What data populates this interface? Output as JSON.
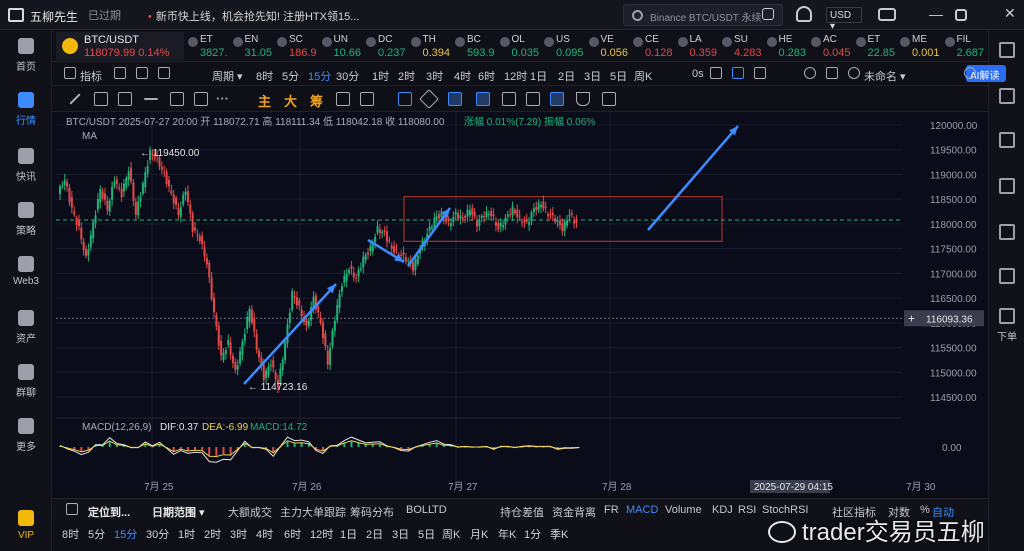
{
  "app": {
    "name": "五柳先生",
    "expired": "已过期",
    "notice": "新币快上线，机会抢先知! 注册HTX领15...",
    "search_placeholder": "Binance BTC/USDT 永续",
    "currency": "USD"
  },
  "left_sidebar": [
    {
      "label": "首页",
      "icon": "home-icon"
    },
    {
      "label": "行情",
      "icon": "bar-chart-icon",
      "active": true
    },
    {
      "label": "快讯",
      "icon": "news-icon"
    },
    {
      "label": "策略",
      "icon": "robot-icon"
    },
    {
      "label": "Web3",
      "icon": "web3-icon"
    },
    {
      "label": "资产",
      "icon": "wallet-icon"
    },
    {
      "label": "群聊",
      "icon": "chat-icon"
    },
    {
      "label": "更多",
      "icon": "apps-icon"
    },
    {
      "label": "VIP",
      "icon": "vip-icon"
    }
  ],
  "ticker_main": {
    "symbol": "BTC/USDT",
    "price": "118079.99",
    "change": "0.14%"
  },
  "tickers": [
    {
      "sym": "ET",
      "price": "3827.",
      "color": "#1fb37a"
    },
    {
      "sym": "EN",
      "price": "31.05",
      "color": "#1fb37a"
    },
    {
      "sym": "SC",
      "price": "186.9",
      "color": "#e24a4a"
    },
    {
      "sym": "UN",
      "price": "10.66",
      "color": "#1fb37a"
    },
    {
      "sym": "DC",
      "price": "0.237",
      "color": "#1fb37a"
    },
    {
      "sym": "TH",
      "price": "0.394",
      "color": "#e8c547"
    },
    {
      "sym": "BC",
      "price": "593.9",
      "color": "#1fb37a"
    },
    {
      "sym": "OL",
      "price": "0.035",
      "color": "#1fb37a"
    },
    {
      "sym": "US",
      "price": "0.095",
      "color": "#1fb37a"
    },
    {
      "sym": "VE",
      "price": "0.056",
      "color": "#e8c547"
    },
    {
      "sym": "CE",
      "price": "0.128",
      "color": "#e24a4a"
    },
    {
      "sym": "LA",
      "price": "0.359",
      "color": "#e24a4a"
    },
    {
      "sym": "SU",
      "price": "4.283",
      "color": "#e24a4a"
    },
    {
      "sym": "HE",
      "price": "0.283",
      "color": "#1fb37a"
    },
    {
      "sym": "AC",
      "price": "0.045",
      "color": "#e24a4a"
    },
    {
      "sym": "ET",
      "price": "22.85",
      "color": "#1fb37a"
    },
    {
      "sym": "ME",
      "price": "0.001",
      "color": "#e8c547"
    },
    {
      "sym": "FIL",
      "price": "2.687",
      "color": "#1fb37a"
    }
  ],
  "toolbar1": {
    "indicators": "指标",
    "period": "周期",
    "intervals": [
      "8时",
      "5分",
      "15分",
      "30分",
      "1时",
      "2时",
      "3时",
      "4时",
      "6时",
      "12时",
      "1日",
      "2日",
      "3日",
      "5日",
      "周K"
    ],
    "active_interval": "15分",
    "zero_s": "0s",
    "layout_name": "未命名",
    "ai": "AI解读"
  },
  "toolbar2": {
    "text_tools": [
      "主",
      "大",
      "筹"
    ]
  },
  "chart_data": {
    "type": "candlestick",
    "symbol": "BTC/USDT",
    "info_line": {
      "time": "2025-07-27 20:00",
      "open_label": "开",
      "open": "118072.71",
      "high_label": "高",
      "high": "118111.34",
      "low_label": "低",
      "low": "118042.18",
      "close_label": "收",
      "close": "118080.00",
      "change_label": "涨幅",
      "change": "0.01%(7.29)",
      "amp_label": "振幅",
      "amp": "0.06%"
    },
    "ma_label": "MA",
    "y_ticks": [
      "120000.00",
      "119500.00",
      "119000.00",
      "118500.00",
      "118000.00",
      "117500.00",
      "117000.00",
      "116500.00",
      "116000.00",
      "115500.00",
      "115000.00",
      "114500.00"
    ],
    "ylim": [
      114200,
      120100
    ],
    "x_ticks": [
      "7月 25",
      "7月 26",
      "7月 27",
      "7月 28",
      "7月 30"
    ],
    "cursor_time": "2025-07-29 04:15",
    "cursor_price": "116093.36",
    "high_annotation": "119450.00",
    "low_annotation": "114723.16",
    "current_price_line": 118080,
    "cursor_price_value": 116093.36,
    "macd": {
      "label": "MACD(12,26,9)",
      "dif_label": "DIF:",
      "dif": "0.37",
      "dea_label": "DEA:",
      "dea": "-6.99",
      "macd_label": "MACD:",
      "macd_value": "14.72",
      "zero": "0.00"
    },
    "zone": {
      "price_low": 117650,
      "price_high": 118550
    },
    "close_path": [
      118600,
      118900,
      118300,
      117900,
      117300,
      118000,
      118700,
      118300,
      118900,
      118600,
      119100,
      118200,
      118800,
      119450,
      119300,
      119000,
      118600,
      118200,
      118700,
      117900,
      117700,
      117200,
      116200,
      115300,
      115600,
      115000,
      115600,
      116300,
      115500,
      114900,
      115200,
      114723,
      115600,
      116600,
      116300,
      115900,
      116500,
      116000,
      115200,
      116100,
      116800,
      117100,
      116900,
      117300,
      117500,
      117900,
      117800,
      117500,
      117400,
      117300,
      117100,
      117500,
      117800,
      118100,
      118200,
      118000,
      118200,
      118100,
      118300,
      118000,
      118200,
      118200,
      117900,
      118100,
      118300,
      118100,
      118000,
      118300,
      118400,
      118200,
      118100,
      117900,
      118200,
      118000
    ]
  },
  "bottombar1": {
    "position": "定位到...",
    "date_range": "日期范围",
    "items": [
      "大额成交",
      "主力大单跟踪",
      "筹码分布",
      "BOLL",
      "TD",
      "持仓差值",
      "资金背离",
      "FR",
      "MACD",
      "Volume",
      "KDJ",
      "RSI",
      "StochRSI"
    ],
    "active": "MACD",
    "right": [
      "社区指标",
      "对数",
      "%",
      "自动"
    ]
  },
  "bottombar2": {
    "items": [
      "8时",
      "5分",
      "15分",
      "30分",
      "1时",
      "2时",
      "3时",
      "4时",
      "6时",
      "12时",
      "1日",
      "2日",
      "3日",
      "5日",
      "周K",
      "月K",
      "年K",
      "1分",
      "季K"
    ],
    "active": "15分"
  },
  "right_sidebar_label": "下单",
  "watermark": "trader交易员五柳"
}
